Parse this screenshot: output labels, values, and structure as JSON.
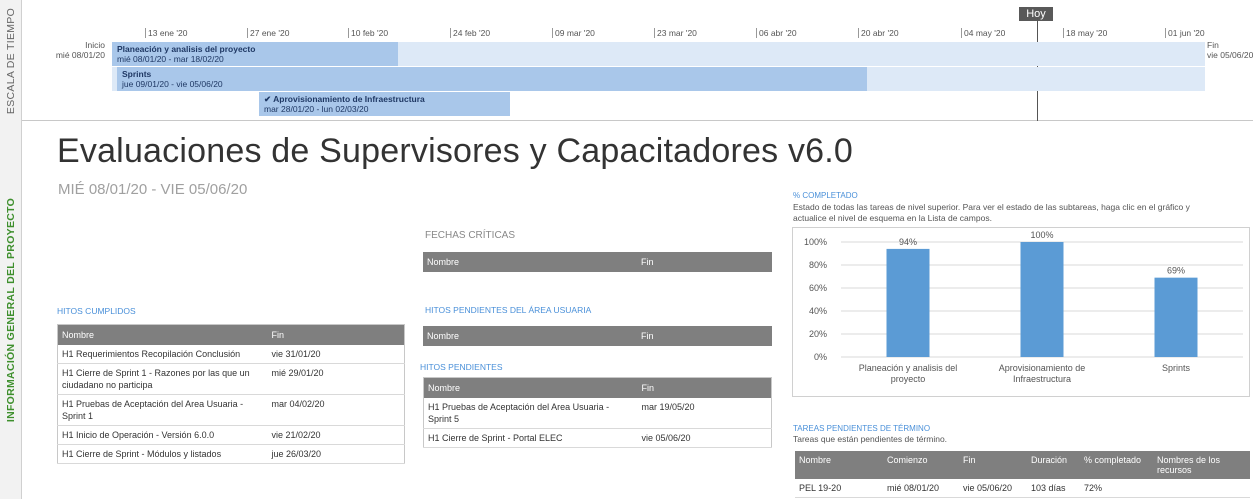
{
  "timeline": {
    "side_label": "ESCALA DE TIEMPO",
    "today_label": "Hoy",
    "ticks": [
      "13 ene '20",
      "27 ene '20",
      "10 feb '20",
      "24 feb '20",
      "09 mar '20",
      "23 mar '20",
      "06 abr '20",
      "20 abr '20",
      "04 may '20",
      "18 may '20",
      "01 jun '20"
    ],
    "start_label": "Inicio",
    "start_date": "mié 08/01/20",
    "end_label": "Fin",
    "end_date": "vie 05/06/20",
    "bars": [
      {
        "title": "Planeación y analisis del proyecto",
        "dates": "mié 08/01/20 - mar 18/02/20"
      },
      {
        "title": "Sprints",
        "dates": "jue 09/01/20 - vie 05/06/20"
      },
      {
        "title": "✔ Aprovisionamiento de Infraestructura",
        "dates": "mar 28/01/20 - lun 02/03/20"
      }
    ]
  },
  "info": {
    "side_label": "INFORMACIÓN GENERAL DEL PROYECTO",
    "title": "Evaluaciones de Supervisores y Capacitadores v6.0",
    "subtitle": "MIÉ 08/01/20 -  VIE 05/06/20"
  },
  "fechas_criticas": {
    "heading": "FECHAS CRÍTICAS",
    "columns": [
      "Nombre",
      "Fin"
    ]
  },
  "hitos_cumplidos": {
    "heading": "HITOS CUMPLIDOS",
    "columns": [
      "Nombre",
      "Fin"
    ],
    "rows": [
      [
        "H1 Requerimientos Recopilación Conclusión",
        "vie 31/01/20"
      ],
      [
        "H1 Cierre de Sprint 1 - Razones por las que un ciudadano no participa",
        "mié 29/01/20"
      ],
      [
        "H1 Pruebas de Aceptación del Area Usuaria - Sprint 1",
        "mar 04/02/20"
      ],
      [
        "H1 Inicio de Operación - Versión 6.0.0",
        "vie 21/02/20"
      ],
      [
        "H1 Cierre de Sprint - Módulos y listados",
        "jue 26/03/20"
      ]
    ]
  },
  "hitos_area_usuaria": {
    "heading": "HITOS PENDIENTES DEL ÁREA USUARIA",
    "columns": [
      "Nombre",
      "Fin"
    ]
  },
  "hitos_pendientes": {
    "heading": "HITOS PENDIENTES",
    "columns": [
      "Nombre",
      "Fin"
    ],
    "rows": [
      [
        "H1 Pruebas de Aceptación del Area Usuaria - Sprint 5",
        "mar 19/05/20"
      ],
      [
        "H1 Cierre de Sprint - Portal ELEC",
        "vie 05/06/20"
      ]
    ]
  },
  "completado": {
    "heading": "% COMPLETADO",
    "description": "Estado de todas las tareas de nivel superior. Para ver el estado de las subtareas, haga clic en el gráfico y actualice el nivel de esquema en la Lista de campos."
  },
  "chart_data": {
    "type": "bar",
    "categories": [
      "Planeación y analisis del proyecto",
      "Aprovisionamiento de Infraestructura",
      "Sprints"
    ],
    "category_lines": [
      [
        "Planeación y analisis del",
        "proyecto"
      ],
      [
        "Aprovisionamiento de",
        "Infraestructura"
      ],
      [
        "Sprints"
      ]
    ],
    "values": [
      94,
      100,
      69
    ],
    "value_labels": [
      "94%",
      "100%",
      "69%"
    ],
    "ylim": [
      0,
      100
    ],
    "yticks": [
      "0%",
      "20%",
      "40%",
      "60%",
      "80%",
      "100%"
    ],
    "grid": true,
    "bar_color": "#5b9bd5"
  },
  "tareas_pendientes": {
    "heading": "TAREAS PENDIENTES DE TÉRMINO",
    "description": "Tareas que están pendientes de término.",
    "columns": [
      "Nombre",
      "Comienzo",
      "Fin",
      "Duración",
      "% completado",
      "Nombres de los recursos"
    ],
    "rows": [
      [
        "PEL 19-20",
        "mié 08/01/20",
        "vie 05/06/20",
        "103 días",
        "72%",
        ""
      ]
    ]
  },
  "colors": {
    "accent": "#4a90d9",
    "bar": "#a9c7ea",
    "track": "#dde9f7",
    "header_gray": "#7f7f7f",
    "side_green": "#3e8f2d"
  }
}
